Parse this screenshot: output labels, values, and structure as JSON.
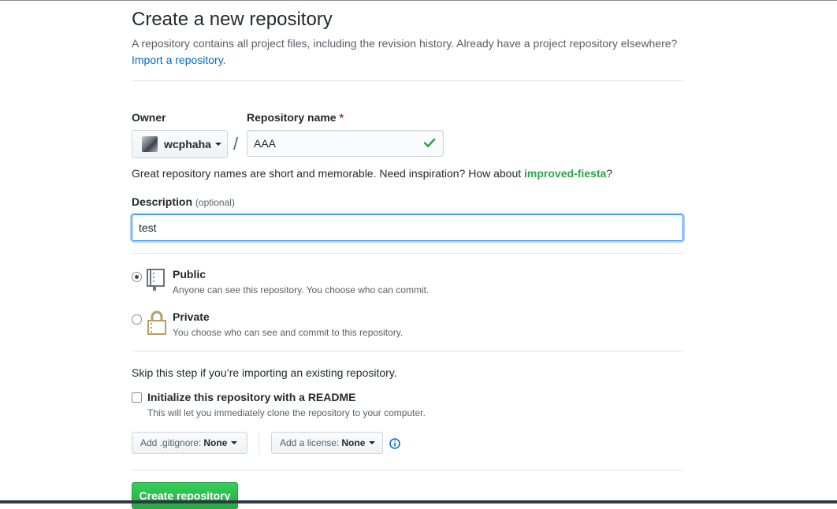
{
  "page": {
    "title": "Create a new repository",
    "subhead_text": "A repository contains all project files, including the revision history. Already have a project repository elsewhere?",
    "import_link": "Import a repository."
  },
  "owner": {
    "label": "Owner",
    "value": "wcphaha"
  },
  "repo": {
    "label": "Repository name",
    "required_mark": "*",
    "value": "AAA",
    "separator": "/"
  },
  "hint": {
    "text": "Great repository names are short and memorable. Need inspiration? How about ",
    "suggestion": "improved-fiesta",
    "end": "?"
  },
  "description": {
    "label": "Description",
    "optional": "(optional)",
    "value": "test"
  },
  "visibility": {
    "public": {
      "title": "Public",
      "note": "Anyone can see this repository. You choose who can commit.",
      "selected": true
    },
    "private": {
      "title": "Private",
      "note": "You choose who can see and commit to this repository.",
      "selected": false
    }
  },
  "init": {
    "skip_text": "Skip this step if you’re importing an existing repository.",
    "readme_label": "Initialize this repository with a README",
    "readme_note": "This will let you immediately clone the repository to your computer.",
    "readme_checked": false
  },
  "gitignore": {
    "prefix": "Add .gitignore:",
    "value": "None"
  },
  "license": {
    "prefix": "Add a license:",
    "value": "None"
  },
  "submit": {
    "label": "Create repository"
  },
  "colors": {
    "accent_green": "#28a745",
    "link_blue": "#0366d6",
    "focus_blue": "#2188ff"
  },
  "icons": {
    "check": "check-icon",
    "public": "repo-book-icon",
    "private": "lock-icon",
    "info": "info-icon"
  }
}
